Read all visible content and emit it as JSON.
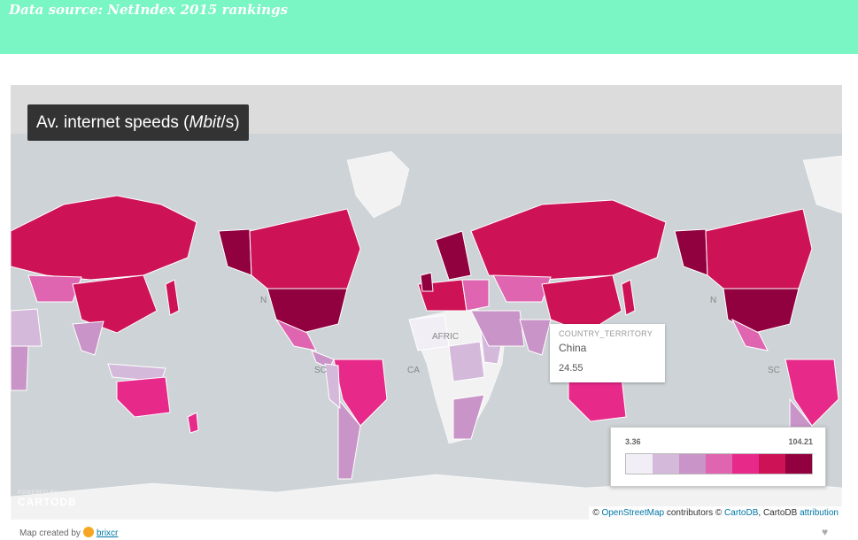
{
  "banner": {
    "text": "Data source: NetIndex 2015 rankings"
  },
  "map": {
    "title_prefix": "Av. internet speeds (",
    "title_unit": "Mbit",
    "title_suffix": "/s)",
    "labels": [
      "N",
      "AFRIC",
      "SC",
      "CA",
      "SC",
      "N"
    ],
    "tooltip": {
      "field": "COUNTRY_TERRITORY",
      "country": "China",
      "value": "24.55"
    },
    "legend": {
      "min": "3.36",
      "max": "104.21",
      "colors": [
        "#f1eef6",
        "#d4b9da",
        "#c994c7",
        "#df65b0",
        "#e7298a",
        "#ce1256",
        "#91003f"
      ]
    },
    "logo": {
      "powered": "POWERED BY",
      "brand": "CARTODB"
    },
    "attribution": {
      "prefix": "© ",
      "osm": "OpenStreetMap",
      "mid": " contributors © ",
      "cartodb": "CartoDB",
      "sep": ", CartoDB ",
      "attr": "attribution"
    }
  },
  "footer": {
    "prefix": "Map created by",
    "author": "brixcr"
  },
  "colors": {
    "banner": "#7af5c4",
    "ocean": "#cdd3d6",
    "land_nodata": "#f2f2f2",
    "title_bg": "#333333"
  }
}
